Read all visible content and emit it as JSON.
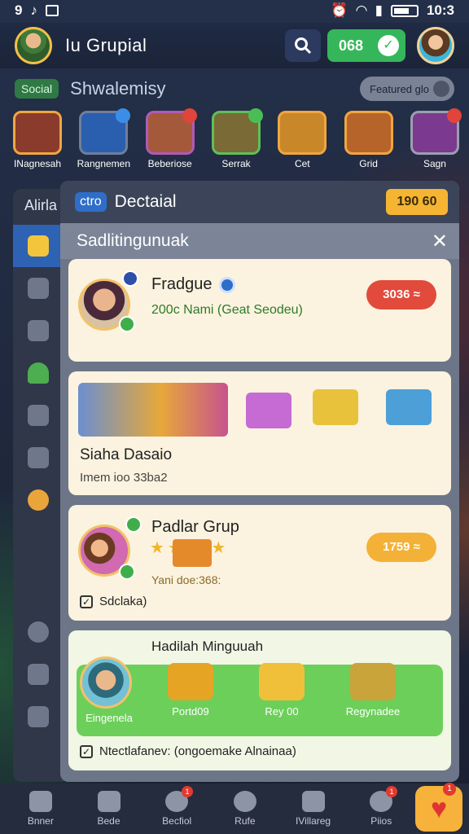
{
  "status_bar": {
    "left_icons": [
      "9",
      "♪"
    ],
    "time": "10:3"
  },
  "header": {
    "title": "Iu  Grupial",
    "coin_label": "068"
  },
  "section": {
    "tag": "Social",
    "title": "Shwalemisy",
    "toggle_label": "Featured glo"
  },
  "categories": [
    {
      "label": "INagnesah",
      "badge": "",
      "color": "#8a3b2b"
    },
    {
      "label": "Rangnemen",
      "badge": "",
      "color": "#2a5fb0"
    },
    {
      "label": "Beberiose",
      "badge": "",
      "color": "#a45a3a"
    },
    {
      "label": "Serrak",
      "badge": "",
      "color": "#7a6a35"
    },
    {
      "label": "Cet",
      "badge": "",
      "color": "#c8882a"
    },
    {
      "label": "Grid",
      "badge": "",
      "color": "#b7642a"
    },
    {
      "label": "Sagn",
      "badge": "",
      "color": "#7b3a8f"
    }
  ],
  "sidebar": {
    "head": "Alirla",
    "items": [
      "active",
      "",
      "",
      "",
      "",
      "",
      "",
      "",
      "",
      ""
    ]
  },
  "panel": {
    "tag": "ctro",
    "title": "Dectaial",
    "price": "190 60",
    "subtitle": "Sadlitingunuak",
    "close": "✕"
  },
  "cards": {
    "first": {
      "name": "Fradgue",
      "desc": "200c Nami (Geat Seodeu)",
      "button": "3036 ≈"
    },
    "second": {
      "name": "Siaha Dasaio",
      "desc": "Imem ioo 33ba2"
    },
    "third": {
      "name": "Padlar Grup",
      "desc": "Yani doe:368:",
      "check_label": "Sdclaka)",
      "button": "1759 ≈"
    },
    "fourth": {
      "title": "Hadilah Minguuah",
      "rewards": [
        "Eingenela",
        "Portd09",
        "Rey 00",
        "Regynadee"
      ],
      "check_label": "Ntectlafanev: (ongoemake Alnainaa)"
    }
  },
  "bottom_nav": [
    {
      "label": "Bnner",
      "badge": ""
    },
    {
      "label": "Bede",
      "badge": ""
    },
    {
      "label": "Becfiol",
      "badge": "1"
    },
    {
      "label": "Rufe",
      "badge": ""
    },
    {
      "label": "IVillareg",
      "badge": ""
    },
    {
      "label": "Piios",
      "badge": "1"
    }
  ],
  "heart_badge": "1"
}
